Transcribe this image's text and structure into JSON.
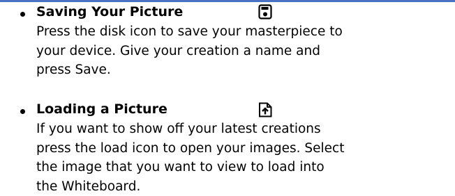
{
  "items": [
    {
      "heading": "Saving Your Picture",
      "icon": "floppy-disk-icon",
      "lines": [
        "Press the disk icon to save your masterpiece to",
        "your device.  Give your creation a name and",
        "press Save."
      ]
    },
    {
      "heading": "Loading a Picture",
      "icon": "file-upload-icon",
      "lines": [
        "If you want to show off your latest creations",
        "press the load icon to open your images.  Select",
        "the image that you want to view to load into",
        "the Whiteboard."
      ]
    }
  ],
  "colors": {
    "top_rule": "#4a72c4",
    "text": "#000000"
  }
}
